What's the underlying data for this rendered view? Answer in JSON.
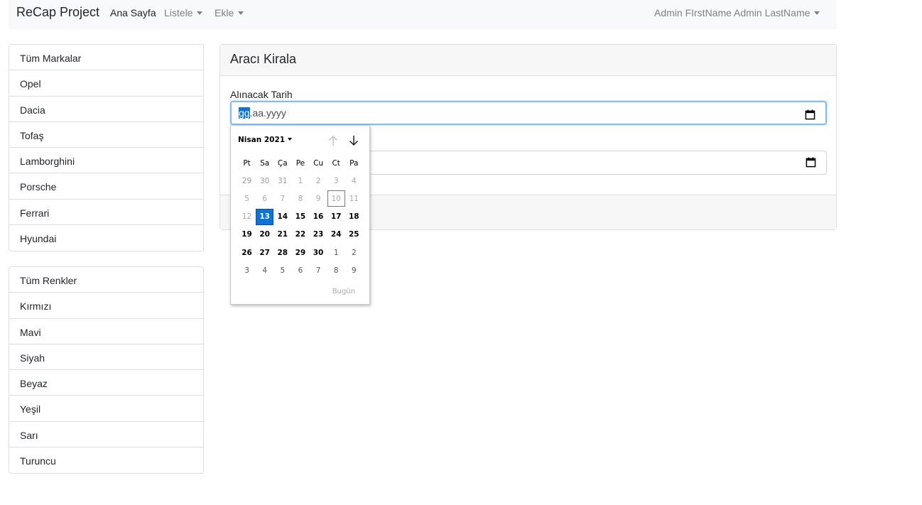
{
  "navbar": {
    "brand": "ReCap Project",
    "links": [
      {
        "label": "Ana Sayfa"
      },
      {
        "label": "Listele"
      },
      {
        "label": "Ekle"
      }
    ],
    "user": "Admin FIrstName Admin LastName"
  },
  "brands": [
    "Tüm Markalar",
    "Opel",
    "Dacia",
    "Tofaş",
    "Lamborghini",
    "Porsche",
    "Ferrari",
    "Hyundai"
  ],
  "colors": [
    "Tüm Renkler",
    "Kırmızı",
    "Mavi",
    "Siyah",
    "Beyaz",
    "Yeşil",
    "Sarı",
    "Turuncu"
  ],
  "card": {
    "title": "Aracı Kirala",
    "pickup_label": "Alınacak Tarih",
    "pickup_placeholder_day": "gg",
    "pickup_placeholder_rest": ".aa.yyyy",
    "return_label": "",
    "return_placeholder": ""
  },
  "datepicker": {
    "month_label": "Nisan 2021",
    "weekdays": [
      "Pt",
      "Sa",
      "Ça",
      "Pe",
      "Cu",
      "Ct",
      "Pa"
    ],
    "weeks": [
      [
        "29",
        "30",
        "31",
        "1",
        "2",
        "3",
        "4"
      ],
      [
        "5",
        "6",
        "7",
        "8",
        "9",
        "10",
        "11"
      ],
      [
        "12",
        "13",
        "14",
        "15",
        "16",
        "17",
        "18"
      ],
      [
        "19",
        "20",
        "21",
        "22",
        "23",
        "24",
        "25"
      ],
      [
        "26",
        "27",
        "28",
        "29",
        "30",
        "1",
        "2"
      ],
      [
        "3",
        "4",
        "5",
        "6",
        "7",
        "8",
        "9"
      ]
    ],
    "selected_day": "13",
    "today_day": "10",
    "today_button": "Bugün"
  },
  "accent_color": "#0a74da"
}
